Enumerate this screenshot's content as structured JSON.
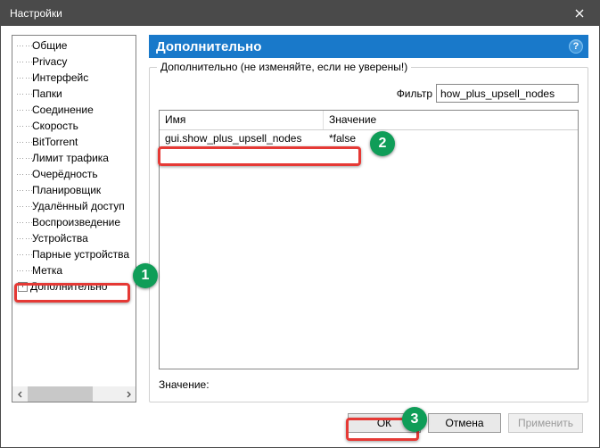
{
  "window": {
    "title": "Настройки"
  },
  "sidebar": {
    "items": [
      "Общие",
      "Privacy",
      "Интерфейс",
      "Папки",
      "Соединение",
      "Скорость",
      "BitTorrent",
      "Лимит трафика",
      "Очерёдность",
      "Планировщик",
      "Удалённый доступ",
      "Воспроизведение",
      "Устройства",
      "Парные устройства",
      "Метка"
    ],
    "expandable_item": "Дополнительно"
  },
  "main": {
    "heading": "Дополнительно",
    "groupbox_title": "Дополнительно (не изменяйте, если не уверены!)",
    "filter_label": "Фильтр",
    "filter_value": "how_plus_upsell_nodes",
    "table": {
      "col_name": "Имя",
      "col_value": "Значение",
      "row": {
        "name": "gui.show_plus_upsell_nodes",
        "value": "*false"
      }
    },
    "value_label": "Значение:"
  },
  "buttons": {
    "ok": "ОК",
    "cancel": "Отмена",
    "apply": "Применить"
  },
  "annotations": {
    "b1": "1",
    "b2": "2",
    "b3": "3"
  }
}
